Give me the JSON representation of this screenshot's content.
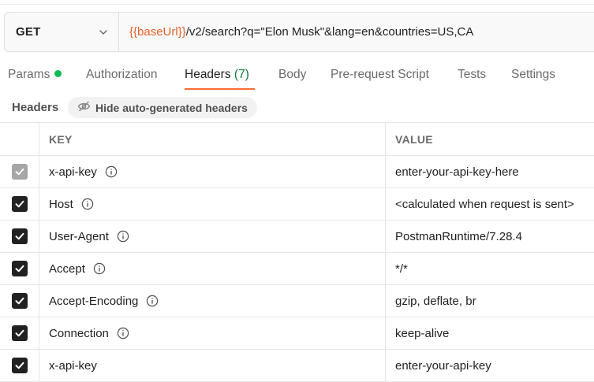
{
  "request": {
    "method": "GET",
    "url_variable": "{{baseUrl}}",
    "url_rest": "/v2/search?q=\"Elon Musk\"&lang=en&countries=US,CA"
  },
  "tabs": [
    {
      "label": "Params"
    },
    {
      "label": "Authorization"
    },
    {
      "label": "Headers",
      "count": "(7)"
    },
    {
      "label": "Body"
    },
    {
      "label": "Pre-request Script"
    },
    {
      "label": "Tests"
    },
    {
      "label": "Settings"
    }
  ],
  "subbar": {
    "title": "Headers",
    "hide_button": "Hide auto-generated headers"
  },
  "table": {
    "columns": [
      "KEY",
      "VALUE"
    ],
    "rows": [
      {
        "key": "x-api-key",
        "value": "enter-your-api-key-here",
        "checked": true,
        "disabled": true,
        "info": true
      },
      {
        "key": "Host",
        "value": "<calculated when request is sent>",
        "checked": true,
        "disabled": false,
        "info": true
      },
      {
        "key": "User-Agent",
        "value": "PostmanRuntime/7.28.4",
        "checked": true,
        "disabled": false,
        "info": true
      },
      {
        "key": "Accept",
        "value": "*/*",
        "checked": true,
        "disabled": false,
        "info": true
      },
      {
        "key": "Accept-Encoding",
        "value": "gzip, deflate, br",
        "checked": true,
        "disabled": false,
        "info": true
      },
      {
        "key": "Connection",
        "value": "keep-alive",
        "checked": true,
        "disabled": false,
        "info": true
      },
      {
        "key": "x-api-key",
        "value": "enter-your-api-key",
        "checked": true,
        "disabled": false,
        "info": false
      }
    ]
  },
  "colors": {
    "accent": "#ff6c37",
    "variable": "#e5612a",
    "status_dot": "#0cbb52",
    "count": "#0c7a3d"
  },
  "icons": {
    "method_dropdown": "chevron-down-icon",
    "hide_button": "eye-slash-icon",
    "row_info": "info-icon",
    "row_check": "checkbox-checked-icon"
  }
}
